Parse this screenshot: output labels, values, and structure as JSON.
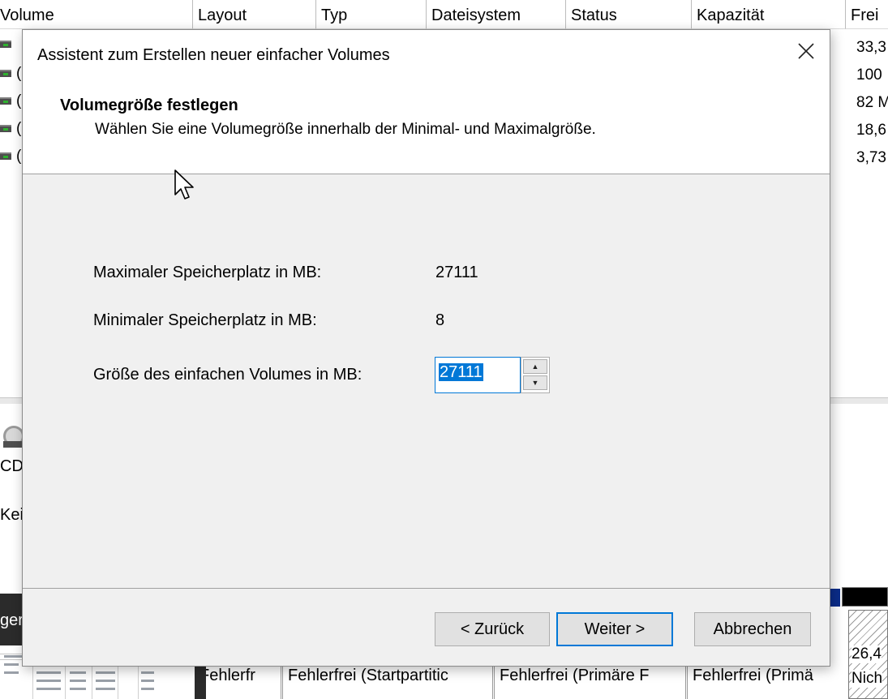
{
  "background": {
    "columns": [
      "Volume",
      "Layout",
      "Typ",
      "Dateisystem",
      "Status",
      "Kapazität",
      "Frei"
    ],
    "free_values": [
      "33,3",
      "100",
      "82 M",
      "18,6",
      "3,73"
    ],
    "left_labels": {
      "cd": "CD",
      "kein": "Kei"
    },
    "hatch_labels": [
      "26,4",
      "Nich"
    ],
    "partition_status": [
      "Fehlerfr",
      "Fehlerfrei (Startpartitic",
      "Fehlerfrei (Primäre F",
      "Fehlerfrei (Primä"
    ],
    "taskbar_preview_title": "gerverwaltung",
    "volume_icon_semantic": "volume-drive-icon"
  },
  "dialog": {
    "title": "Assistent zum Erstellen neuer einfacher Volumes",
    "close_glyph": "✕",
    "heading": "Volumegröße festlegen",
    "subheading": "Wählen Sie eine Volumegröße innerhalb der Minimal- und Maximalgröße.",
    "fields": {
      "max_label": "Maximaler Speicherplatz in MB:",
      "max_value": "27111",
      "min_label": "Minimaler Speicherplatz in MB:",
      "min_value": "8",
      "size_label": "Größe des einfachen Volumes in MB:",
      "size_value": "27111"
    },
    "buttons": {
      "back": "< Zurück",
      "next": "Weiter >",
      "cancel": "Abbrechen"
    }
  },
  "colors": {
    "accent": "#0078d7",
    "dialog_bg": "#f0f0f0"
  }
}
